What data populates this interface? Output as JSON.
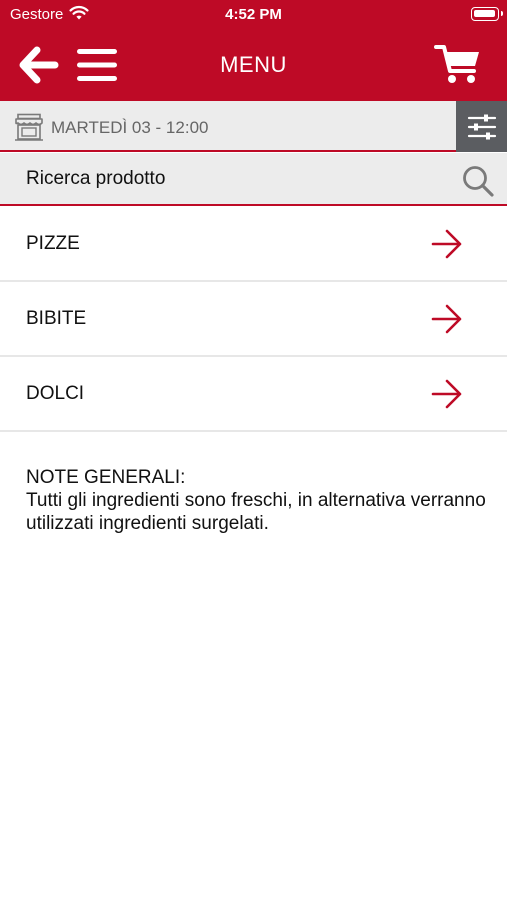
{
  "status_bar": {
    "carrier": "Gestore",
    "time": "4:52 PM"
  },
  "header": {
    "title": "MENU",
    "back_icon": "arrow-left-icon",
    "menu_icon": "hamburger-icon",
    "cart_icon": "shopping-cart-icon"
  },
  "pickup": {
    "icon": "shop-icon",
    "label": "MARTEDÌ 03 - 12:00",
    "filter_icon": "sliders-icon"
  },
  "search": {
    "placeholder": "Ricerca prodotto",
    "value": "",
    "icon": "search-icon"
  },
  "categories": [
    {
      "label": "PIZZE",
      "icon": "arrow-right-icon"
    },
    {
      "label": "BIBITE",
      "icon": "arrow-right-icon"
    },
    {
      "label": "DOLCI",
      "icon": "arrow-right-icon"
    }
  ],
  "notes": {
    "title": "NOTE GENERALI:",
    "body": "Tutti gli ingredienti sono freschi, in alternativa verranno utilizzati ingredienti surgelati."
  },
  "colors": {
    "brand_red": "#be0a26",
    "bar_gray": "#ececec",
    "filter_gray": "#5b5d61"
  }
}
